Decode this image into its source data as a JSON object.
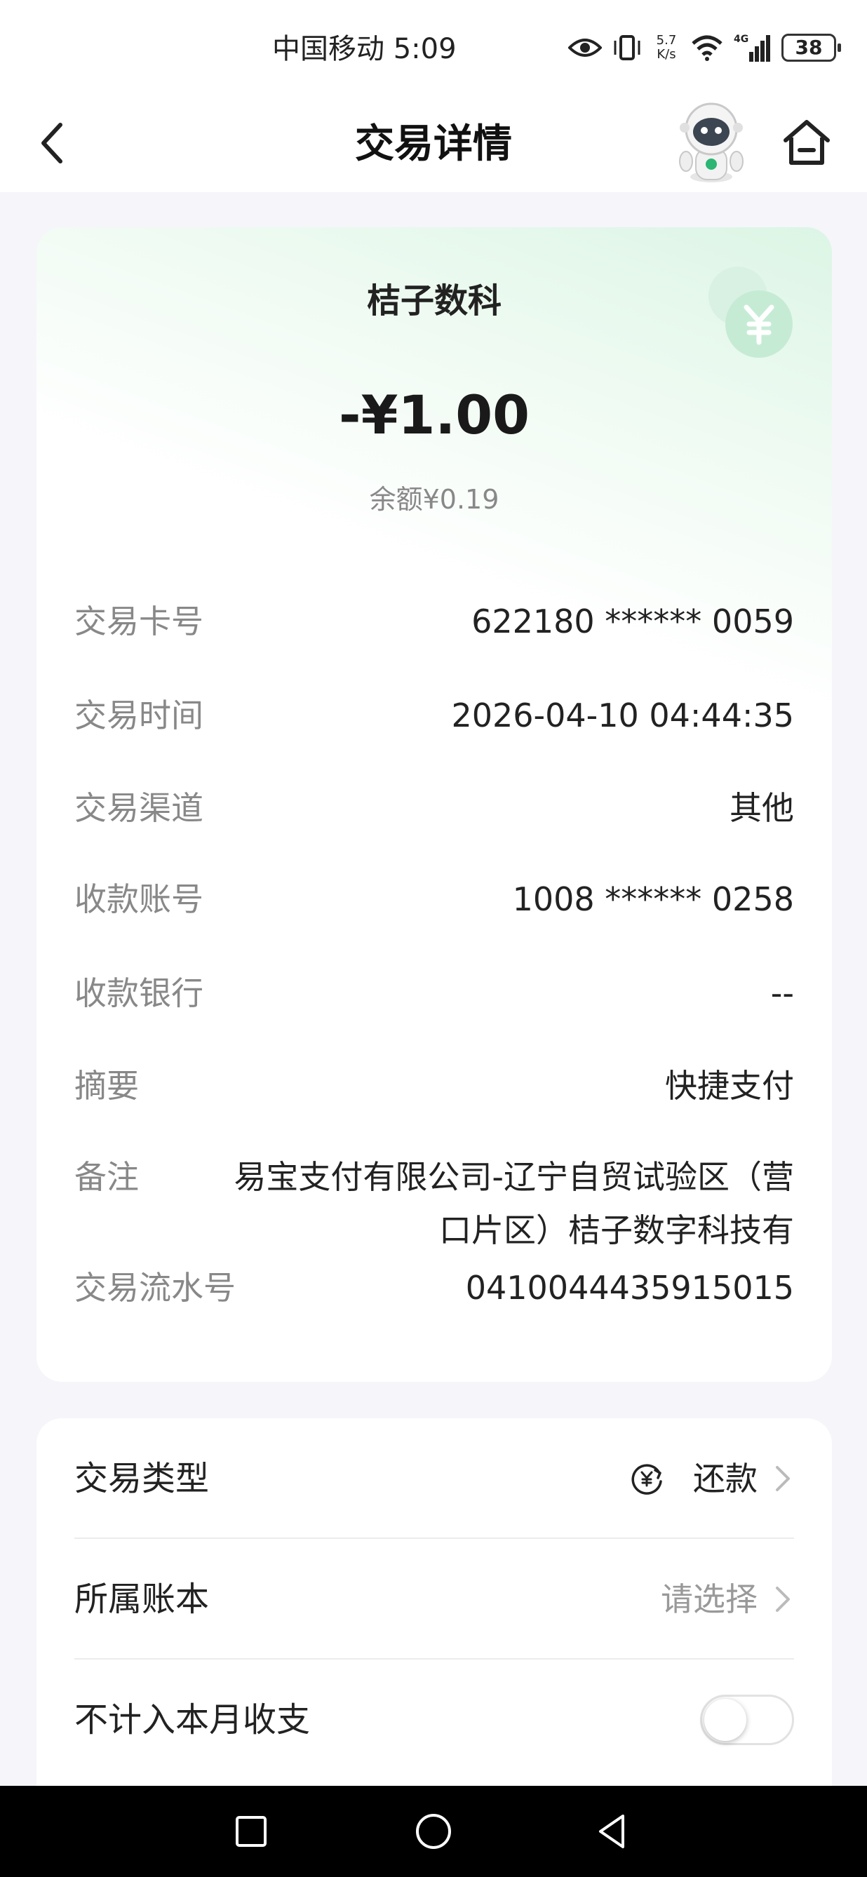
{
  "status_bar": {
    "carrier_time": "中国移动 5:09",
    "speed_top": "5.7",
    "speed_bottom": "K/s",
    "network": "4G",
    "battery": "38"
  },
  "nav": {
    "title": "交易详情"
  },
  "transaction": {
    "merchant": "桔子数科",
    "amount": "-¥1.00",
    "balance": "余额¥0.19",
    "rows": [
      {
        "label": "交易卡号",
        "value": "622180 ****** 0059"
      },
      {
        "label": "交易时间",
        "value": "2026-04-10 04:44:35"
      },
      {
        "label": "交易渠道",
        "value": "其他"
      },
      {
        "label": "收款账号",
        "value": "1008 ****** 0258"
      },
      {
        "label": "收款银行",
        "value": "--"
      },
      {
        "label": "摘要",
        "value": "快捷支付"
      },
      {
        "label": "备注",
        "value": "易宝支付有限公司-辽宁自贸试验区（营口片区）桔子数字科技有"
      },
      {
        "label": "交易流水号",
        "value": "0410044435915015"
      }
    ]
  },
  "settings": {
    "type_label": "交易类型",
    "type_value": "还款",
    "book_label": "所属账本",
    "book_value": "请选择",
    "exclude_label": "不计入本月收支",
    "exclude_on": false
  },
  "colors": {
    "accent_green": "#2bb673",
    "background": "#f5f5fa"
  }
}
